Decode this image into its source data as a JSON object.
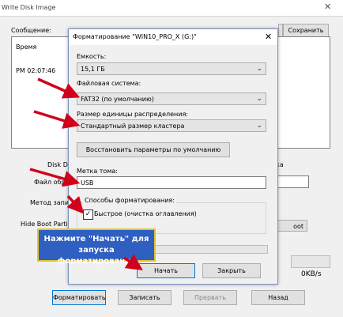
{
  "background_window": {
    "title": "Write Disk Image",
    "message_label": "Сообщение:",
    "save_button": "Сохранить",
    "log_header": "Время",
    "log_time": "PM 02:07:46",
    "disk_drive_label": "Disk Driv",
    "check_label": "ерка",
    "file_label": "Файл обр",
    "method_label": "Метод запис",
    "hide_boot_label": "Hide Boot Partitio",
    "boot_button": "oot",
    "speed": "0KB/s",
    "buttons": {
      "format": "Форматировать",
      "write": "Записать",
      "cancel": "Прервать",
      "back": "Назад"
    }
  },
  "dialog": {
    "title": "Форматирование \"WIN10_PRO_X (G:)\"",
    "capacity_label": "Емкость:",
    "capacity_value": "15,1 ГБ",
    "filesystem_label": "Файловая система:",
    "filesystem_value": "FAT32 (по умолчанию)",
    "unit_label": "Размер единицы распределения:",
    "unit_value": "Стандартный размер кластера",
    "restore_defaults_button": "Восстановить параметры по умолчанию",
    "volume_label": "Метка тома:",
    "volume_value": "USB",
    "methods_label": "Способы форматирования:",
    "quick_label": "Быстрое (очистка оглавления)",
    "quick_checked": true,
    "start_button": "Начать",
    "close_button": "Закрыть"
  },
  "callout": {
    "line1": "Нажмите \"Начать\" для",
    "line2": "запуска форматирования"
  },
  "colors": {
    "arrow": "#d0021b",
    "callout_bg": "#2e5fc1",
    "callout_border": "#e2c52a",
    "focus_border": "#0078d7"
  }
}
